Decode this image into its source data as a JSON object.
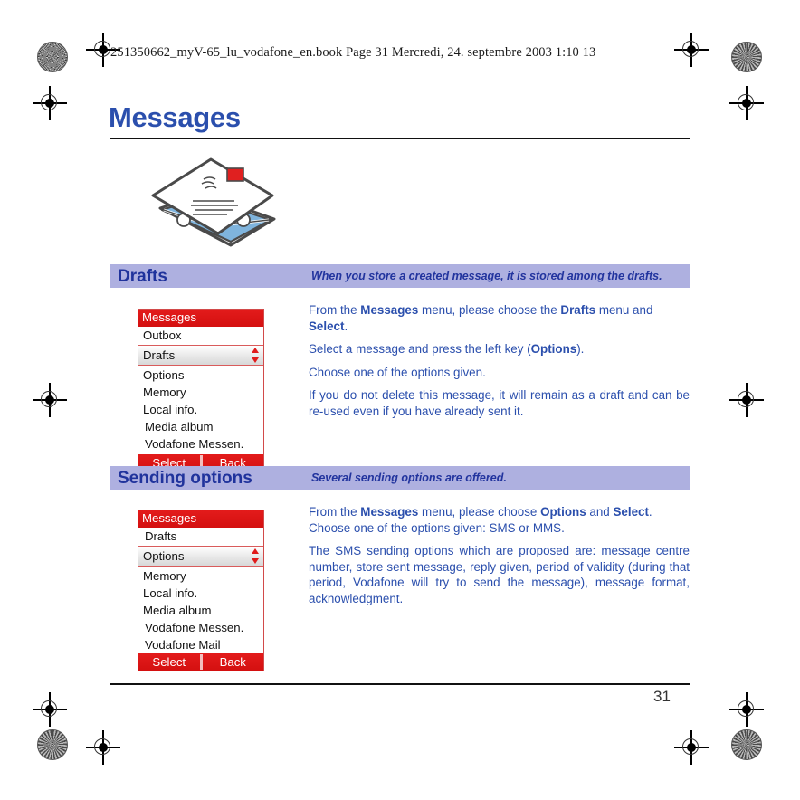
{
  "print_header": {
    "text": "251350662_myV-65_lu_vodafone_en.book  Page 31  Mercredi, 24. septembre 2003  1:10 13"
  },
  "page": {
    "title": "Messages",
    "number": "31",
    "illustration_name": "envelope-with-letter-illustration"
  },
  "colors": {
    "title_blue": "#2b4fad",
    "section_bar": "#aeb0e0",
    "section_title": "#20339c",
    "phone_red": "#e01b1b",
    "body_text": "#2b4fad"
  },
  "sections": [
    {
      "id": "drafts",
      "title": "Drafts",
      "subtitle": "When you store a created message, it is stored among the drafts.",
      "phone": {
        "titlebar": "Messages",
        "rows_above": [
          "Outbox"
        ],
        "selected": "Drafts",
        "rows_below": [
          "Options",
          "Memory",
          "Local info.",
          "Media album",
          "Vodafone Messen."
        ],
        "softkey_left": "Select",
        "softkey_right": "Back"
      },
      "paragraphs": [
        {
          "parts": [
            {
              "t": "From the ",
              "b": false
            },
            {
              "t": "Messages",
              "b": true
            },
            {
              "t": " menu, please choose the ",
              "b": false
            },
            {
              "t": "Drafts",
              "b": true
            },
            {
              "t": " menu and ",
              "b": false
            },
            {
              "t": "Select",
              "b": true
            },
            {
              "t": ".",
              "b": false
            }
          ],
          "justify": false
        },
        {
          "parts": [
            {
              "t": "Select a message and press the left key (",
              "b": false
            },
            {
              "t": "Options",
              "b": true
            },
            {
              "t": ").",
              "b": false
            }
          ],
          "justify": false
        },
        {
          "parts": [
            {
              "t": "Choose one of the options given.",
              "b": false
            }
          ],
          "justify": false
        },
        {
          "parts": [
            {
              "t": "If you do not delete this message, it will remain as a draft and can be re-used even if you have already sent it.",
              "b": false
            }
          ],
          "justify": true
        }
      ]
    },
    {
      "id": "sending-options",
      "title": "Sending options",
      "subtitle": "Several sending options are offered.",
      "phone": {
        "titlebar": "Messages",
        "rows_above": [
          "Drafts"
        ],
        "selected": "Options",
        "rows_below": [
          "Memory",
          "Local info.",
          "Media album",
          "Vodafone Messen.",
          "Vodafone Mail"
        ],
        "softkey_left": "Select",
        "softkey_right": "Back"
      },
      "paragraphs": [
        {
          "parts": [
            {
              "t": "From the ",
              "b": false
            },
            {
              "t": "Messages",
              "b": true
            },
            {
              "t": " menu, please choose ",
              "b": false
            },
            {
              "t": "Options",
              "b": true
            },
            {
              "t": " and ",
              "b": false
            },
            {
              "t": "Select",
              "b": true
            },
            {
              "t": ".",
              "b": false
            }
          ],
          "justify": false
        },
        {
          "parts": [
            {
              "t": "Choose one of the options given: SMS or MMS.",
              "b": false
            }
          ],
          "justify": false
        },
        {
          "parts": [
            {
              "t": "The SMS sending options which are proposed are: message centre number, store sent message, reply given, period of validity (during that period, Vodafone will try to send the message), message format, acknowledgment.",
              "b": false
            }
          ],
          "justify": true
        }
      ]
    }
  ]
}
